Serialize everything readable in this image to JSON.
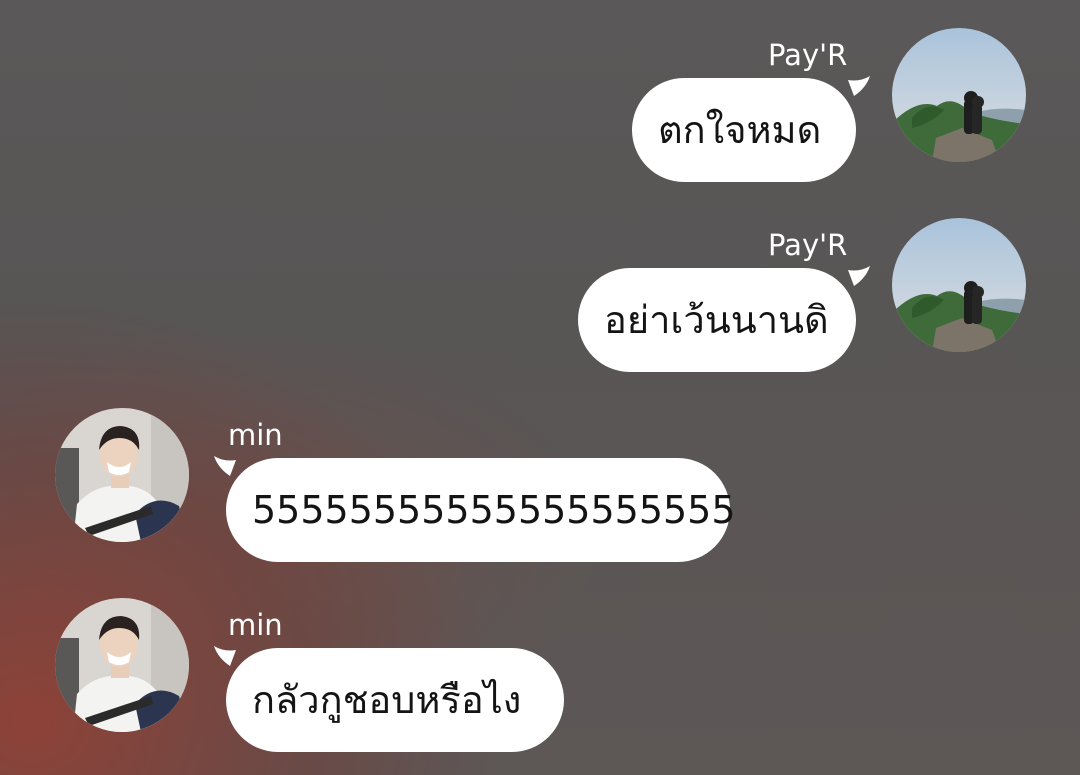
{
  "messages": [
    {
      "sender": "Pay'R",
      "text": "ตกใจหมด",
      "side": "right",
      "avatar": "landscape-avatar-icon"
    },
    {
      "sender": "Pay'R",
      "text": "อย่าเว้นนานดิ",
      "side": "right",
      "avatar": "landscape-avatar-icon"
    },
    {
      "sender": "min",
      "text": "55555555555555555555",
      "side": "left",
      "avatar": "person-avatar-icon"
    },
    {
      "sender": "min",
      "text": "กลัวกูชอบหรือไง",
      "side": "left",
      "avatar": "person-avatar-icon"
    }
  ],
  "colors": {
    "bubble": "#ffffff",
    "text": "#141414",
    "sender_name": "#ffffff"
  }
}
